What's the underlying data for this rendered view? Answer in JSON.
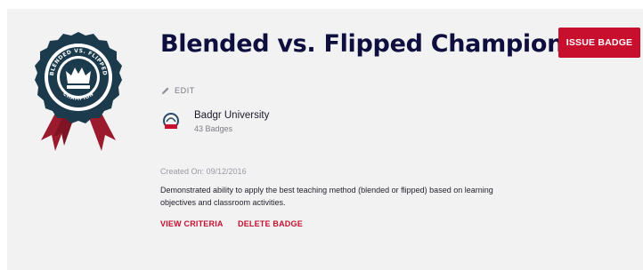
{
  "badge": {
    "title": "Blended vs. Flipped Champion",
    "art_ring_text_top": "BLENDED VS. FLIPPED",
    "art_ring_text_bottom": "CHAMPION",
    "colors": {
      "navy": "#1b3a4b",
      "ribbon": "#9b1a2e"
    }
  },
  "actions": {
    "issue_label": "ISSUE BADGE",
    "edit_label": "EDIT",
    "view_criteria_label": "VIEW CRITERIA",
    "delete_label": "DELETE BADGE"
  },
  "issuer": {
    "name": "Badgr University",
    "badge_count": "43 Badges",
    "logo_icon": "badgr-logo-icon"
  },
  "details": {
    "created": "Created On: 09/12/2016",
    "description": "Demonstrated ability to apply the best teaching method (blended or flipped) based on learning objectives and classroom activities."
  },
  "colors": {
    "accent": "#c8102e",
    "title": "#0e0e3f",
    "card_bg": "#f2f2f3"
  }
}
